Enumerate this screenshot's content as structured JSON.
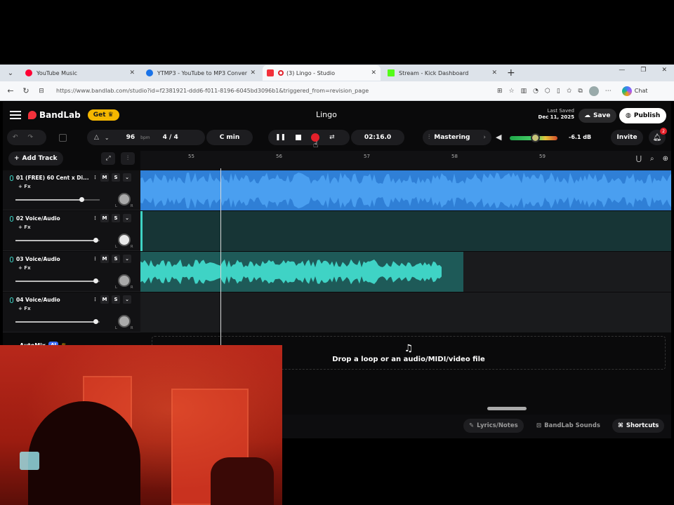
{
  "browser": {
    "tabs": [
      {
        "title": "YouTube Music",
        "color": "#ff0033"
      },
      {
        "title": "YTMP3 - YouTube to MP3 Convert",
        "color": "#1a73e8"
      },
      {
        "title": "(3) Lingo - Studio",
        "color": "#f3313b"
      },
      {
        "title": "Stream - Kick Dashboard",
        "color": "#53fc18"
      }
    ],
    "url": "https://www.bandlab.com/studio?id=f2381921-ddd6-f011-8196-6045bd3096b1&triggered_from=revision_page",
    "chat_label": "Chat"
  },
  "app": {
    "brand": "BandLab",
    "get_label": "Get",
    "project_name": "Lingo",
    "last_saved_label": "Last Saved",
    "last_saved_date": "Dec 11, 2025",
    "save_label": "Save",
    "publish_label": "Publish",
    "tempo": "96",
    "tempo_unit": "bpm",
    "time_signature": "4 / 4",
    "key": "C min",
    "time": "02:16.0",
    "mastering_label": "Mastering",
    "volume_db": "-6.1 dB",
    "invite_label": "Invite",
    "notification_count": "2",
    "add_track_label": "Add Track",
    "ruler": [
      "55",
      "56",
      "57",
      "58",
      "59"
    ],
    "tracks": [
      {
        "name": "01  (FREE) 60 Cent x Di...",
        "fx": "+ Fx",
        "mute": "M",
        "solo": "S",
        "volume": 0.78
      },
      {
        "name": "02  Voice/Audio",
        "fx": "+ Fx",
        "mute": "M",
        "solo": "S",
        "volume": 0.95
      },
      {
        "name": "03  Voice/Audio",
        "fx": "+ Fx",
        "mute": "M",
        "solo": "S",
        "volume": 0.95
      },
      {
        "name": "04  Voice/Audio",
        "fx": "+ Fx",
        "mute": "M",
        "solo": "S",
        "volume": 0.95
      }
    ],
    "pan_labels": {
      "left": "L",
      "right": "R"
    },
    "automix_label": "AutoMix",
    "ai_label": "AI",
    "drop_zone_text": "Drop a loop or an audio/MIDI/video file",
    "lyrics_label": "Lyrics/Notes",
    "sounds_label": "BandLab Sounds",
    "shortcuts_label": "Shortcuts"
  },
  "colors": {
    "track1_wave": "#3a8fe8",
    "track2_lane": "#1e4445",
    "track3_wave": "#36c3ae",
    "record": "#e3202a",
    "get_badge": "#f5b700"
  }
}
